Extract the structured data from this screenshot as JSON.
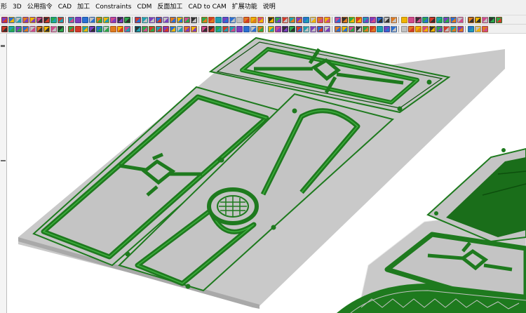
{
  "menu": {
    "items": [
      {
        "label": "形"
      },
      {
        "label": "3D"
      },
      {
        "label": "公用指令"
      },
      {
        "label": "CAD"
      },
      {
        "label": "加工"
      },
      {
        "label": "Constraints"
      },
      {
        "label": "CDM"
      },
      {
        "label": "反面加工"
      },
      {
        "label": "CAD to CAM"
      },
      {
        "label": "扩展功能"
      },
      {
        "label": "说明"
      }
    ]
  },
  "colors": {
    "toolbar_bg": "#f0f0f0",
    "plate_top": "#c9c9c9",
    "plate_side": "#a8a8a8",
    "groove_green": "#1e7a1e",
    "groove_dark": "#0d4f0d",
    "groove_light": "#3fb03f",
    "fill_green": "#1a6e1a"
  },
  "toolbars": {
    "row1_icons": [
      "open-icon",
      "save-icon",
      "undo-icon",
      "zoom-icon",
      "pan-icon",
      "rotate-icon",
      "select-icon",
      "layer-icon",
      "snap-icon",
      "grid-icon",
      "measure-icon",
      "view-icon",
      "render-icon",
      "settings-icon"
    ],
    "row2_icons": [
      "line-icon",
      "arc-icon",
      "circle-icon",
      "rect-icon",
      "polyline-icon",
      "trim-icon",
      "offset-icon",
      "mirror-icon",
      "array-icon",
      "text-icon",
      "dimension-icon",
      "fillet-icon"
    ]
  }
}
